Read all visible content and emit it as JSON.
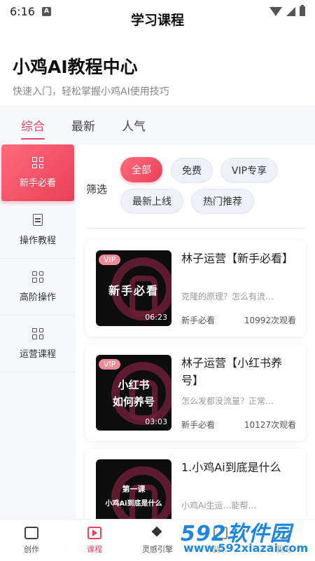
{
  "status_bar": {
    "time": "6:16",
    "notif_label": "A"
  },
  "nav": {
    "title": "学习课程"
  },
  "hero": {
    "title": "小鸡AI教程中心",
    "subtitle": "快速入门，轻松掌握小鸡AI使用技巧"
  },
  "tabs": [
    {
      "label": "综合",
      "active": true
    },
    {
      "label": "最新",
      "active": false
    },
    {
      "label": "人气",
      "active": false
    }
  ],
  "sidebar": {
    "items": [
      {
        "label": "新手必看",
        "icon": "grid-icon",
        "active": true
      },
      {
        "label": "操作教程",
        "icon": "document-icon",
        "active": false
      },
      {
        "label": "高阶操作",
        "icon": "grid-icon",
        "active": false
      },
      {
        "label": "运营课程",
        "icon": "grid-icon",
        "active": false
      }
    ]
  },
  "filters": {
    "label": "筛选",
    "chips": [
      {
        "label": "全部",
        "active": true
      },
      {
        "label": "免费",
        "active": false
      },
      {
        "label": "VIP专享",
        "active": false
      },
      {
        "label": "最新上线",
        "active": false
      },
      {
        "label": "热门推荐",
        "active": false
      }
    ]
  },
  "courses": [
    {
      "badge": "VIP",
      "thumb_text": "新手必看",
      "duration": "06:23",
      "title": "林子运营【新手必看】",
      "desc": "克隆的原理？怎么有流…",
      "tag": "新手必看",
      "views": "10992次观看"
    },
    {
      "badge": "VIP",
      "thumb_text_1": "小红书",
      "thumb_text_2": "如何养号",
      "duration": "03:03",
      "title": "林子运营【小红书养号】",
      "desc": "怎么发都没流量？正常…",
      "tag": "新手必看",
      "views": "10127次观看"
    },
    {
      "thumb_text_1": "第一课",
      "thumb_text_2": "小鸡Ai到底是什么",
      "title": "1.小鸡Ai到底是什么",
      "desc": "小鸡Ai生运…能帮…"
    }
  ],
  "bottom_nav": [
    {
      "label": "创作",
      "icon": "printer-icon",
      "active": false
    },
    {
      "label": "课程",
      "icon": "video-play-icon",
      "active": true
    },
    {
      "label": "灵感引擎",
      "icon": "layers-icon",
      "active": false
    },
    {
      "label": "智能…",
      "icon": "chat-icon",
      "active": false
    },
    {
      "label": "我的",
      "icon": "user-icon",
      "active": false
    }
  ],
  "watermark": {
    "main": "592软件园",
    "url": "www.592xiazai.com"
  },
  "colors": {
    "accent": "#e94560",
    "sidebar_bg": "#f7f8fb",
    "chip_bg": "#eef1f7",
    "watermark": "#1f86e0"
  }
}
